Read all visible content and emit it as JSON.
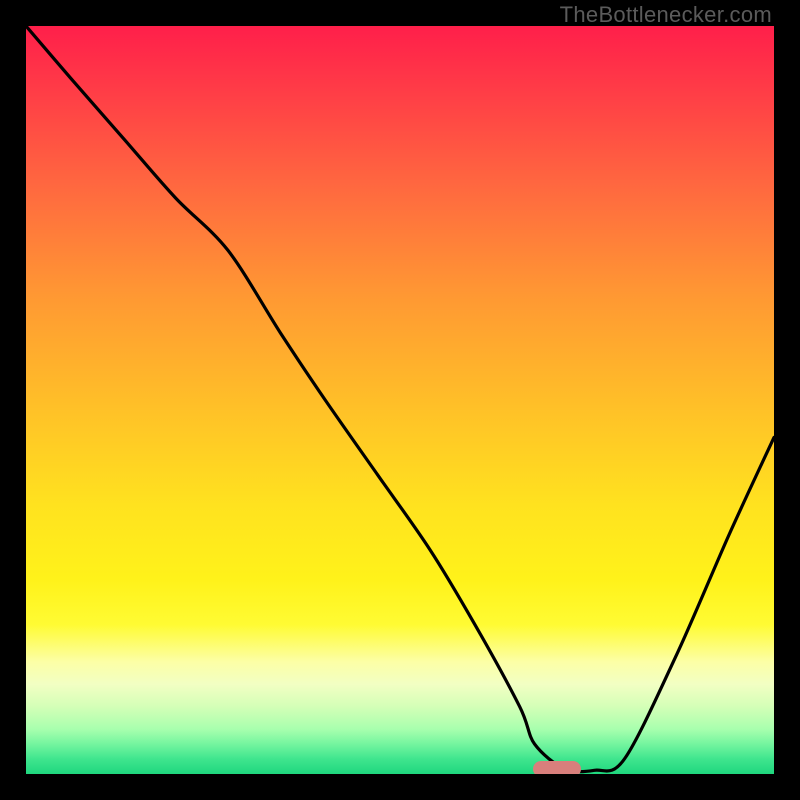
{
  "watermark": "TheBottlenecker.com",
  "chart_data": {
    "type": "line",
    "title": "",
    "xlabel": "",
    "ylabel": "",
    "xlim": [
      0,
      100
    ],
    "ylim": [
      0,
      100
    ],
    "x": [
      0,
      6,
      13,
      20,
      27,
      34,
      40,
      47,
      54,
      60,
      66,
      68,
      72,
      76,
      80,
      87,
      94,
      100
    ],
    "values": [
      100,
      93,
      85,
      77,
      70,
      59,
      50,
      40,
      30,
      20,
      9,
      4,
      0.7,
      0.5,
      2,
      16,
      32,
      45
    ],
    "marker": {
      "x": 71,
      "y": 0.7
    },
    "background_gradient": {
      "top": "#ff1f4a",
      "mid": "#ffe21f",
      "bottom": "#1fd77e"
    }
  }
}
